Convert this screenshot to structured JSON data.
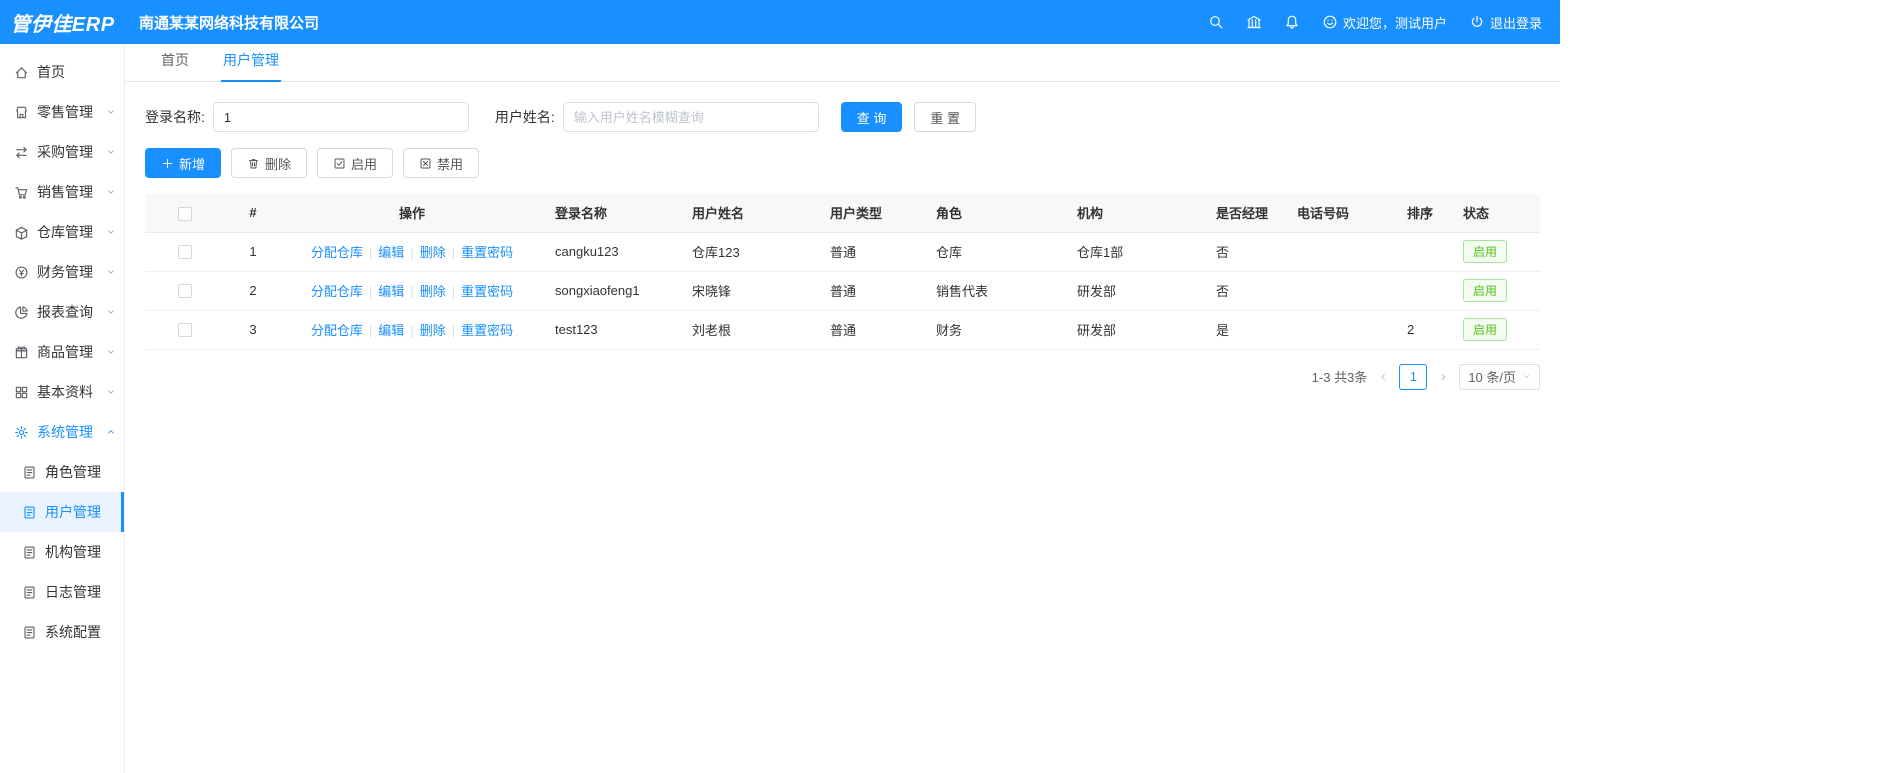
{
  "colors": {
    "primary": "#1890ff",
    "success": "#52c41a",
    "header_bg": "#1890ff",
    "active_menu_bg": "#e8f3ff"
  },
  "header": {
    "logo": "管伊佳ERP",
    "company": "南通某某网络科技有限公司",
    "welcome": "欢迎您，测试用户",
    "logout": "退出登录"
  },
  "tabs": [
    {
      "label": "首页",
      "active": false
    },
    {
      "label": "用户管理",
      "active": true
    }
  ],
  "sidebar": {
    "items": [
      {
        "id": "home",
        "label": "首页",
        "icon": "home"
      },
      {
        "id": "retail",
        "label": "零售管理",
        "icon": "retail",
        "chevron": "down"
      },
      {
        "id": "purchase",
        "label": "采购管理",
        "icon": "purchase",
        "chevron": "down"
      },
      {
        "id": "sales",
        "label": "销售管理",
        "icon": "sales",
        "chevron": "down"
      },
      {
        "id": "warehouse",
        "label": "仓库管理",
        "icon": "warehouse",
        "chevron": "down"
      },
      {
        "id": "finance",
        "label": "财务管理",
        "icon": "finance",
        "chevron": "down"
      },
      {
        "id": "report",
        "label": "报表查询",
        "icon": "report",
        "chevron": "down"
      },
      {
        "id": "goods",
        "label": "商品管理",
        "icon": "goods",
        "chevron": "down"
      },
      {
        "id": "basic",
        "label": "基本资料",
        "icon": "basic",
        "chevron": "down"
      },
      {
        "id": "system",
        "label": "系统管理",
        "icon": "system",
        "chevron": "up",
        "expanded": true
      },
      {
        "id": "role",
        "label": "角色管理",
        "icon": "doc",
        "submenu": true
      },
      {
        "id": "user",
        "label": "用户管理",
        "icon": "doc",
        "submenu": true,
        "active": true
      },
      {
        "id": "org",
        "label": "机构管理",
        "icon": "doc",
        "submenu": true
      },
      {
        "id": "log",
        "label": "日志管理",
        "icon": "doc",
        "submenu": true
      },
      {
        "id": "config",
        "label": "系统配置",
        "icon": "doc",
        "submenu": true
      }
    ]
  },
  "filter": {
    "login_name_label": "登录名称:",
    "login_name_value": "1",
    "user_name_label": "用户姓名:",
    "user_name_placeholder": "输入用户姓名模糊查询",
    "search_label": "查 询",
    "reset_label": "重 置"
  },
  "toolbar": {
    "add_label": "新增",
    "delete_label": "删除",
    "enable_label": "启用",
    "disable_label": "禁用"
  },
  "table": {
    "headers": [
      "#",
      "操作",
      "登录名称",
      "用户姓名",
      "用户类型",
      "角色",
      "机构",
      "是否经理",
      "电话号码",
      "排序",
      "状态"
    ],
    "op_links": [
      "分配仓库",
      "编辑",
      "删除",
      "重置密码"
    ],
    "rows": [
      {
        "index": "1",
        "login": "cangku123",
        "name": "仓库123",
        "type": "普通",
        "role": "仓库",
        "org": "仓库1部",
        "manager": "否",
        "phone": "",
        "sort": "",
        "status": "启用"
      },
      {
        "index": "2",
        "login": "songxiaofeng1",
        "name": "宋晓锋",
        "type": "普通",
        "role": "销售代表",
        "org": "研发部",
        "manager": "否",
        "phone": "",
        "sort": "",
        "status": "启用"
      },
      {
        "index": "3",
        "login": "test123",
        "name": "刘老根",
        "type": "普通",
        "role": "财务",
        "org": "研发部",
        "manager": "是",
        "phone": "",
        "sort": "2",
        "status": "启用"
      }
    ]
  },
  "pagination": {
    "total": "1-3 共3条",
    "prev": "‹",
    "page": "1",
    "next": "›",
    "page_size": "10 条/页"
  }
}
